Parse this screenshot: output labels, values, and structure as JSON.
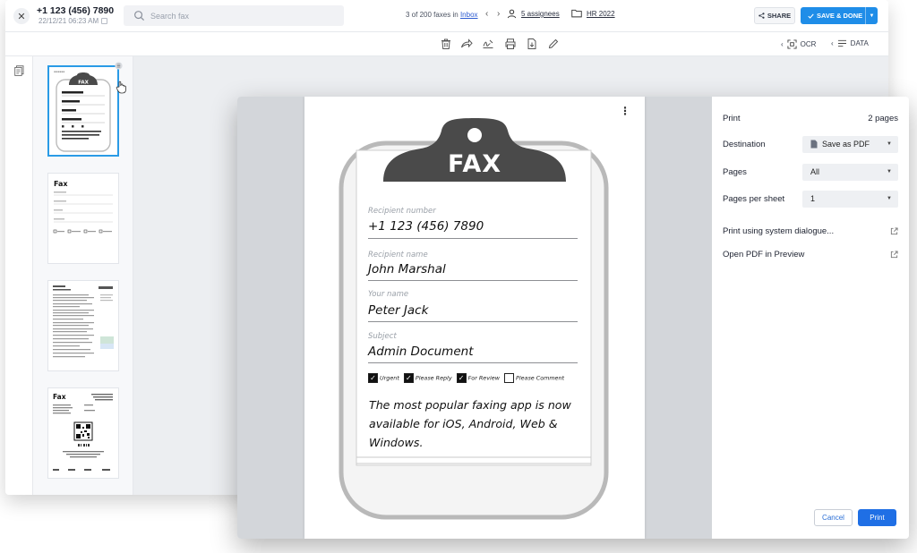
{
  "header": {
    "fax_number": "+1 123 (456) 7890",
    "fax_date": "22/12/21 06:23 AM",
    "search_placeholder": "Search fax",
    "counter_prefix": "3 of 200 faxes in",
    "counter_link": "Inbox",
    "assignees": "5 assignees",
    "folder": "HR 2022",
    "share_label": "SHARE",
    "save_label": "SAVE & DONE"
  },
  "toolbar": {
    "ocr_label": "OCR",
    "data_label": "DATA"
  },
  "thumbnails": {
    "fax_heading": "Fax",
    "fax_art_title": "FAX"
  },
  "preview": {
    "title": "FAX",
    "fields": [
      {
        "label": "Recipient number",
        "value": "+1 123 (456) 7890"
      },
      {
        "label": "Recipient name",
        "value": "John Marshal"
      },
      {
        "label": "Your name",
        "value": "Peter Jack"
      },
      {
        "label": "Subject",
        "value": "Admin Document"
      }
    ],
    "checkboxes": [
      {
        "label": "Urgent",
        "checked": true
      },
      {
        "label": "Please Reply",
        "checked": true
      },
      {
        "label": "For Review",
        "checked": true
      },
      {
        "label": "Please Comment",
        "checked": false
      }
    ],
    "tagline": "The most popular faxing app is now available for iOS, Android, Web & Windows."
  },
  "print": {
    "title": "Print",
    "pages_count": "2 pages",
    "destination_label": "Destination",
    "destination_value": "Save as PDF",
    "pages_label": "Pages",
    "pages_value": "All",
    "per_sheet_label": "Pages per sheet",
    "per_sheet_value": "1",
    "system_dialog": "Print using system dialogue...",
    "open_preview": "Open PDF in Preview",
    "cancel": "Cancel",
    "print": "Print"
  },
  "colors": {
    "accent": "#1f8de8",
    "print_button": "#1f6fe5",
    "clipboard": "#4a4a4a"
  }
}
